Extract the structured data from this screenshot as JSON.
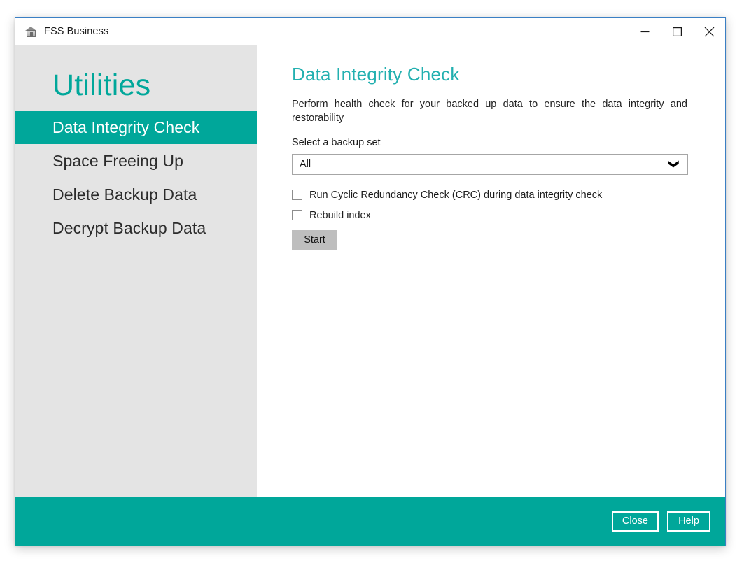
{
  "window": {
    "title": "FSS Business",
    "icon": "app-building-icon",
    "controls": {
      "minimize": "minimize-icon",
      "maximize": "maximize-icon",
      "close": "close-icon"
    }
  },
  "sidebar": {
    "heading": "Utilities",
    "items": [
      {
        "label": "Data Integrity Check",
        "active": true
      },
      {
        "label": "Space Freeing Up",
        "active": false
      },
      {
        "label": "Delete Backup Data",
        "active": false
      },
      {
        "label": "Decrypt Backup Data",
        "active": false
      }
    ]
  },
  "main": {
    "title": "Data Integrity Check",
    "description": "Perform health check for your backed up data to ensure the data integrity and restorability",
    "backup_set": {
      "label": "Select a backup set",
      "selected": "All",
      "chevron": "chevron-down-icon"
    },
    "options": [
      {
        "label": "Run Cyclic Redundancy Check (CRC) during data integrity check",
        "checked": false
      },
      {
        "label": "Rebuild index",
        "checked": false
      }
    ],
    "start_button": "Start"
  },
  "footer": {
    "close_label": "Close",
    "help_label": "Help"
  },
  "colors": {
    "accent_teal": "#00a79a",
    "title_teal": "#23b0b0",
    "sidebar_gray": "#e4e4e4",
    "window_border_blue": "#3a7fc4",
    "start_button_gray": "#bebebe"
  }
}
